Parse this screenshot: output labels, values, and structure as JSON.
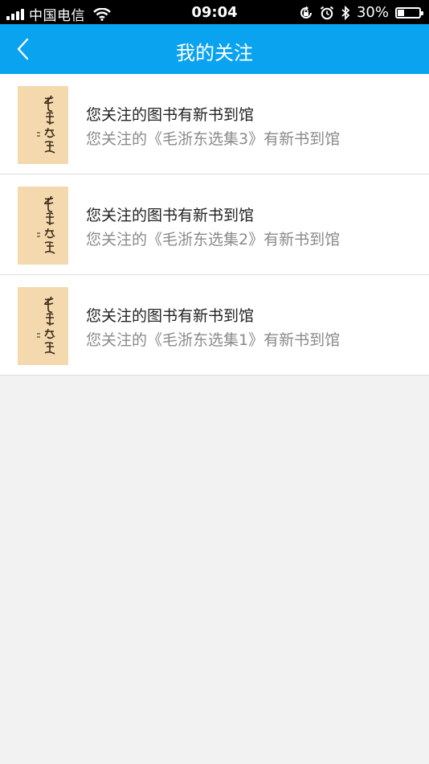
{
  "status_bar": {
    "carrier": "中国电信",
    "time": "09:04",
    "battery": "30%",
    "battery_level": 0.3,
    "icons": [
      "signal-icon",
      "wifi-icon",
      "rotation-lock-icon",
      "alarm-icon",
      "bluetooth-icon",
      "battery-icon"
    ]
  },
  "navbar": {
    "title": "我的关注",
    "back_icon": "chevron-left-icon"
  },
  "colors": {
    "nav_bg": "#0aa3f0",
    "page_bg": "#f2f2f2",
    "title_text": "#222222",
    "subtitle_text": "#8a8a8a",
    "cover_bg": "#f3d9ad"
  },
  "items": [
    {
      "title": "您关注的图书有新书到馆",
      "subtitle": "您关注的《毛浙东选集3》有新书到馆"
    },
    {
      "title": "您关注的图书有新书到馆",
      "subtitle": "您关注的《毛浙东选集2》有新书到馆"
    },
    {
      "title": "您关注的图书有新书到馆",
      "subtitle": "您关注的《毛浙东选集1》有新书到馆"
    }
  ]
}
